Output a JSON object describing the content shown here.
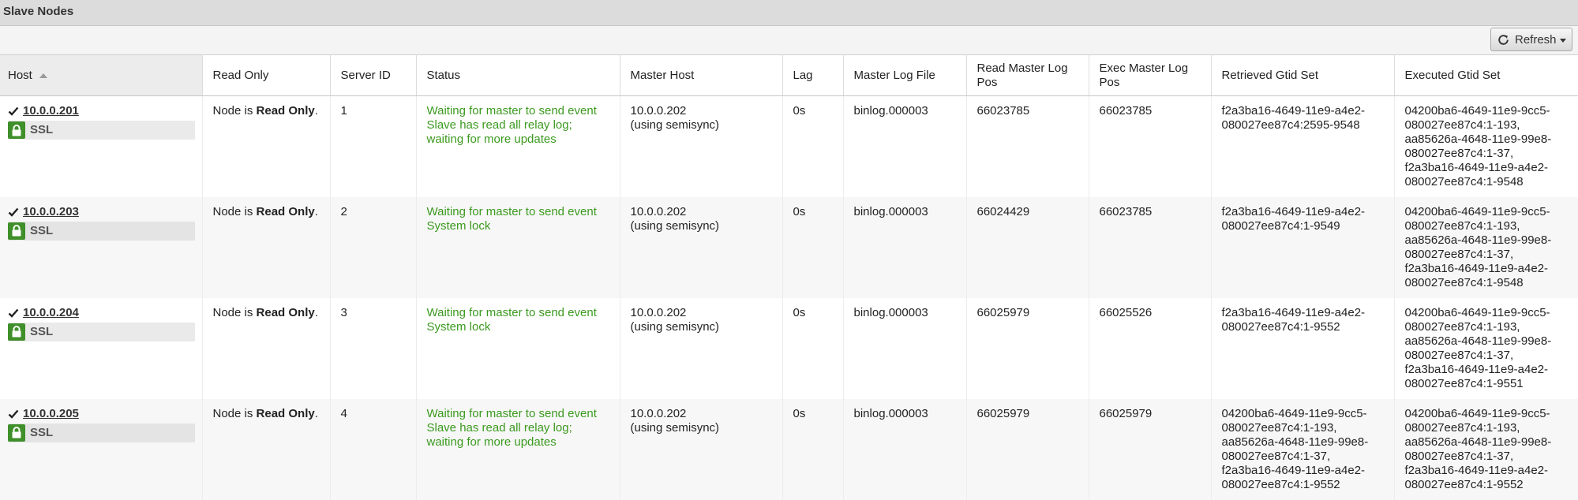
{
  "panel": {
    "title": "Slave Nodes"
  },
  "toolbar": {
    "refresh_label": "Refresh"
  },
  "columns": {
    "host": "Host",
    "read_only": "Read Only",
    "server_id": "Server ID",
    "status": "Status",
    "master_host": "Master Host",
    "lag": "Lag",
    "master_log_file": "Master Log File",
    "read_master_log_pos": "Read Master Log Pos",
    "exec_master_log_pos": "Exec Master Log Pos",
    "retrieved_gtid_set": "Retrieved Gtid Set",
    "executed_gtid_set": "Executed Gtid Set"
  },
  "rows": [
    {
      "host": "10.0.0.201",
      "ssl": "SSL",
      "read_only_prefix": "Node is ",
      "read_only_bold": "Read Only",
      "read_only_suffix": ".",
      "server_id": "1",
      "status_1": "Waiting for master to send event",
      "status_2": "Slave has read all relay log; waiting for more updates",
      "master_host": "10.0.0.202",
      "master_host_note": "(using semisync)",
      "lag": "0s",
      "log_file": "binlog.000003",
      "read_pos": "66023785",
      "exec_pos": "66023785",
      "retrieved": [
        "f2a3ba16-4649-11e9-a4e2-",
        "080027ee87c4:2595-9548"
      ],
      "executed": [
        "04200ba6-4649-11e9-9cc5-",
        "080027ee87c4:1-193,",
        "aa85626a-4648-11e9-99e8-",
        "080027ee87c4:1-37,",
        "f2a3ba16-4649-11e9-a4e2-",
        "080027ee87c4:1-9548"
      ]
    },
    {
      "host": "10.0.0.203",
      "ssl": "SSL",
      "read_only_prefix": "Node is ",
      "read_only_bold": "Read Only",
      "read_only_suffix": ".",
      "server_id": "2",
      "status_1": "Waiting for master to send event",
      "status_2": "System lock",
      "master_host": "10.0.0.202",
      "master_host_note": "(using semisync)",
      "lag": "0s",
      "log_file": "binlog.000003",
      "read_pos": "66024429",
      "exec_pos": "66023785",
      "retrieved": [
        "f2a3ba16-4649-11e9-a4e2-",
        "080027ee87c4:1-9549"
      ],
      "executed": [
        "04200ba6-4649-11e9-9cc5-",
        "080027ee87c4:1-193,",
        "aa85626a-4648-11e9-99e8-",
        "080027ee87c4:1-37,",
        "f2a3ba16-4649-11e9-a4e2-",
        "080027ee87c4:1-9548"
      ]
    },
    {
      "host": "10.0.0.204",
      "ssl": "SSL",
      "read_only_prefix": "Node is ",
      "read_only_bold": "Read Only",
      "read_only_suffix": ".",
      "server_id": "3",
      "status_1": "Waiting for master to send event",
      "status_2": "System lock",
      "master_host": "10.0.0.202",
      "master_host_note": "(using semisync)",
      "lag": "0s",
      "log_file": "binlog.000003",
      "read_pos": "66025979",
      "exec_pos": "66025526",
      "retrieved": [
        "f2a3ba16-4649-11e9-a4e2-",
        "080027ee87c4:1-9552"
      ],
      "executed": [
        "04200ba6-4649-11e9-9cc5-",
        "080027ee87c4:1-193,",
        "aa85626a-4648-11e9-99e8-",
        "080027ee87c4:1-37,",
        "f2a3ba16-4649-11e9-a4e2-",
        "080027ee87c4:1-9551"
      ]
    },
    {
      "host": "10.0.0.205",
      "ssl": "SSL",
      "read_only_prefix": "Node is ",
      "read_only_bold": "Read Only",
      "read_only_suffix": ".",
      "server_id": "4",
      "status_1": "Waiting for master to send event",
      "status_2": "Slave has read all relay log; waiting for more updates",
      "master_host": "10.0.0.202",
      "master_host_note": "(using semisync)",
      "lag": "0s",
      "log_file": "binlog.000003",
      "read_pos": "66025979",
      "exec_pos": "66025979",
      "retrieved": [
        "04200ba6-4649-11e9-9cc5-",
        "080027ee87c4:1-193,",
        "aa85626a-4648-11e9-99e8-",
        "080027ee87c4:1-37,",
        "f2a3ba16-4649-11e9-a4e2-",
        "080027ee87c4:1-9552"
      ],
      "executed": [
        "04200ba6-4649-11e9-9cc5-",
        "080027ee87c4:1-193,",
        "aa85626a-4648-11e9-99e8-",
        "080027ee87c4:1-37,",
        "f2a3ba16-4649-11e9-a4e2-",
        "080027ee87c4:1-9552"
      ]
    }
  ],
  "colors": {
    "status_green": "#3b9a1f",
    "ssl_badge": "#3f8f2a"
  },
  "icons": {
    "check": "check-icon",
    "lock": "lock-icon",
    "refresh": "refresh-icon",
    "sort": "sort-ascending-icon"
  }
}
